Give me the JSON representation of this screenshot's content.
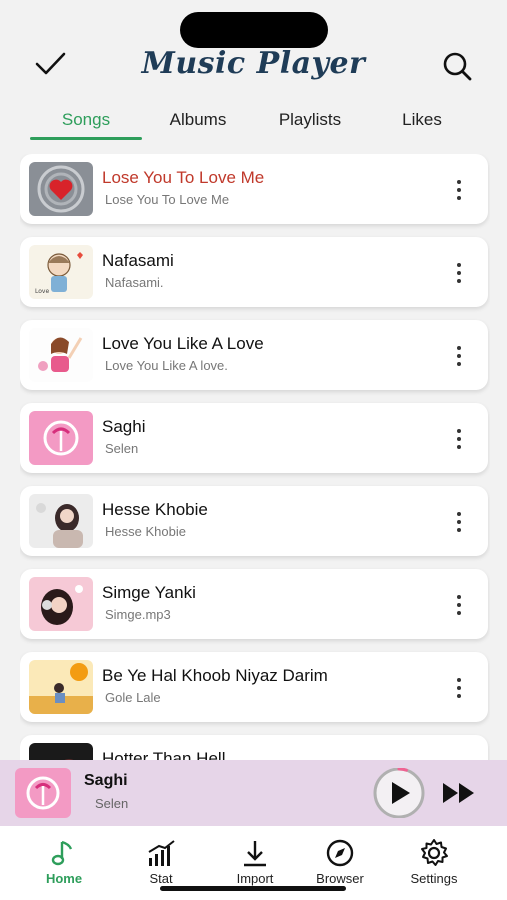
{
  "header": {
    "title": "Music Player",
    "left_icon": "checkmark-icon",
    "right_icon": "search-icon"
  },
  "tabs": [
    {
      "label": "Songs",
      "active": true
    },
    {
      "label": "Albums",
      "active": false
    },
    {
      "label": "Playlists",
      "active": false
    },
    {
      "label": "Likes",
      "active": false
    }
  ],
  "songs": [
    {
      "title": "Lose You To Love Me",
      "subtitle": "Lose You To Love Me",
      "playing": true
    },
    {
      "title": "Nafasami",
      "subtitle": "Nafasami.",
      "playing": false
    },
    {
      "title": "Love You Like A Love",
      "subtitle": "Love You Like A love.",
      "playing": false
    },
    {
      "title": "Saghi",
      "subtitle": "Selen",
      "playing": false
    },
    {
      "title": "Hesse Khobie",
      "subtitle": "Hesse Khobie",
      "playing": false
    },
    {
      "title": "Simge Yanki",
      "subtitle": "Simge.mp3",
      "playing": false
    },
    {
      "title": "Be Ye Hal Khoob Niyaz Darim",
      "subtitle": "Gole Lale",
      "playing": false
    },
    {
      "title": "Hotter Than Hell",
      "subtitle": "",
      "playing": false
    }
  ],
  "now_playing": {
    "title": "Saghi",
    "artist": "Selen",
    "progress": 0.05
  },
  "bottom_nav": [
    {
      "label": "Home",
      "icon": "music-note-icon",
      "active": true
    },
    {
      "label": "Stat",
      "icon": "stats-icon",
      "active": false
    },
    {
      "label": "Import",
      "icon": "download-icon",
      "active": false
    },
    {
      "label": "Browser",
      "icon": "compass-icon",
      "active": false
    },
    {
      "label": "Settings",
      "icon": "gear-icon",
      "active": false
    }
  ],
  "colors": {
    "accent": "#2e9e5b",
    "playing": "#c0392b",
    "title": "#1f3c57",
    "mini_player_bg": "#e6d5e8"
  }
}
